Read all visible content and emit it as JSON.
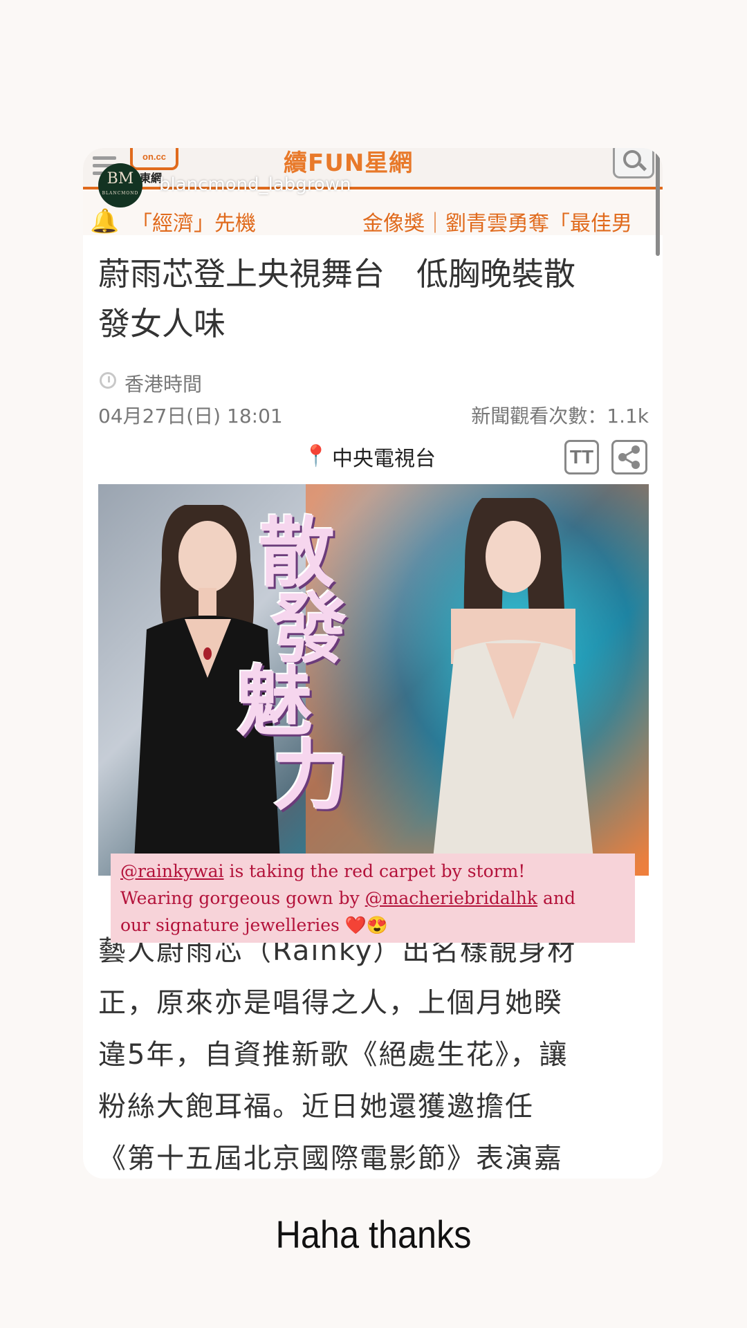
{
  "header": {
    "logo_text": "on.cc",
    "logo_sub": "東網",
    "site_title": "續FUN星網"
  },
  "account": {
    "avatar_monogram": "BM",
    "avatar_brand": "BLANCMOND",
    "username": "blancmond_labgrown"
  },
  "ticker": {
    "item1": "「經濟」先機",
    "item2": "金像獎｜劉青雲勇奪「最佳男"
  },
  "article": {
    "headline_line1": "蔚雨芯登上央視舞台　低胸晚裝散",
    "headline_line2": "發女人味",
    "timezone": "香港時間",
    "datetime": "04月27日(日) 18:01",
    "views": "新聞觀看次數：1.1k",
    "category": "中央電視台",
    "font_button": "TT",
    "image_chars": [
      "散",
      "發",
      "魅",
      "力"
    ],
    "body_lines": [
      "藝人蔚雨芯（Rainky）出名樣靚身材",
      "正，原來亦是唱得之人，上個月她睽",
      "違5年，自資推新歌《絕處生花》，讓",
      "粉絲大飽耳福。近日她還獲邀擔任",
      "《第十五屆北京國際電影節》表演嘉"
    ]
  },
  "caption": {
    "mention1": "@rainkywai",
    "text1": " is taking the red carpet by storm!",
    "text2a": "Wearing gorgeous gown by ",
    "mention2": "@macheriebridalhk",
    "text2b": " and",
    "text3": "our signature jewelleries ",
    "emojis": "❤️😍"
  },
  "story_text": "Haha thanks"
}
